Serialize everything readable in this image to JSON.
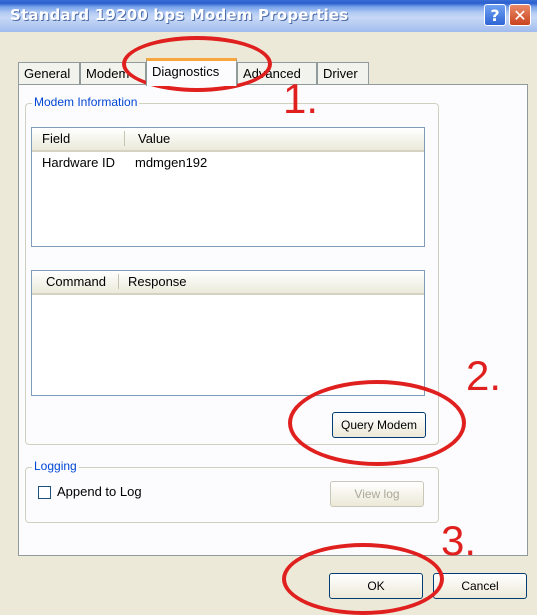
{
  "window": {
    "title": "Standard 19200 bps Modem Properties",
    "help_glyph": "?",
    "close_glyph": "✕"
  },
  "tabs": [
    {
      "label": "General"
    },
    {
      "label": "Modem"
    },
    {
      "label": "Diagnostics"
    },
    {
      "label": "Advanced"
    },
    {
      "label": "Driver"
    }
  ],
  "modem_info": {
    "group_label": "Modem Information",
    "field_header": "Field",
    "value_header": "Value",
    "rows": [
      {
        "field": "Hardware ID",
        "value": "mdmgen192"
      }
    ],
    "command_header": "Command",
    "response_header": "Response",
    "query_button": "Query Modem"
  },
  "logging": {
    "group_label": "Logging",
    "append_label": "Append to Log",
    "append_checked": false,
    "view_log_button": "View log"
  },
  "footer": {
    "ok_button": "OK",
    "cancel_button": "Cancel"
  },
  "annotations": {
    "step1": "1.",
    "step2": "2.",
    "step3": "3.",
    "color": "#e0201e"
  }
}
